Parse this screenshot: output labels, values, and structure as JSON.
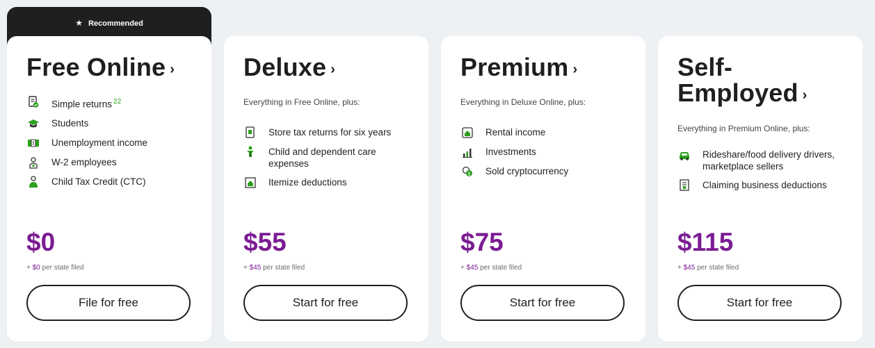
{
  "recommended_badge": "Recommended",
  "colors": {
    "price": "#7b1c93",
    "icon": "#2ca01c"
  },
  "plans": [
    {
      "title": "Free Online",
      "subtitle": "",
      "features": [
        {
          "label": "Simple returns",
          "sup": "22",
          "icon": "document-check-icon"
        },
        {
          "label": "Students",
          "icon": "graduation-cap-icon"
        },
        {
          "label": "Unemployment income",
          "icon": "money-icon"
        },
        {
          "label": "W-2 employees",
          "icon": "employee-badge-icon"
        },
        {
          "label": "Child Tax Credit (CTC)",
          "icon": "child-icon"
        }
      ],
      "price": "$0",
      "state_prefix": "+ ",
      "state_amount": "$0",
      "state_suffix": " per state filed",
      "cta": "File for free"
    },
    {
      "title": "Deluxe",
      "subtitle": "Everything in Free Online, plus:",
      "features": [
        {
          "label": "Store tax returns for six years",
          "icon": "document-storage-icon"
        },
        {
          "label": "Child and dependent care expenses",
          "icon": "child-care-icon"
        },
        {
          "label": "Itemize deductions",
          "icon": "house-document-icon"
        }
      ],
      "price": "$55",
      "state_prefix": "+ ",
      "state_amount": "$45",
      "state_suffix": " per state filed",
      "cta": "Start for free"
    },
    {
      "title": "Premium",
      "subtitle": "Everything in Deluxe Online, plus:",
      "features": [
        {
          "label": "Rental income",
          "icon": "rental-house-icon"
        },
        {
          "label": "Investments",
          "icon": "bar-chart-icon"
        },
        {
          "label": "Sold cryptocurrency",
          "icon": "crypto-coin-icon"
        }
      ],
      "price": "$75",
      "state_prefix": "+ ",
      "state_amount": "$45",
      "state_suffix": " per state filed",
      "cta": "Start for free"
    },
    {
      "title": "Self-Employed",
      "subtitle": "Everything in Premium Online, plus:",
      "features": [
        {
          "label": "Rideshare/food delivery drivers, marketplace sellers",
          "icon": "car-icon"
        },
        {
          "label": "Claiming business deductions",
          "icon": "receipt-icon"
        }
      ],
      "price": "$115",
      "state_prefix": "+ ",
      "state_amount": "$45",
      "state_suffix": " per state filed",
      "cta": "Start for free"
    }
  ]
}
